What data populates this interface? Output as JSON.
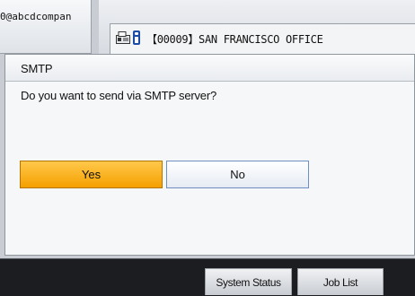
{
  "background": {
    "address_text": "0@abcdcompan",
    "destination_text": "【00009】SAN FRANCISCO OFFICE"
  },
  "dialog": {
    "title": "SMTP",
    "message": "Do you want to send via SMTP server?",
    "yes_label": "Yes",
    "no_label": "No"
  },
  "bottom_bar": {
    "system_status_label": "System Status",
    "job_list_label": "Job List"
  },
  "colors": {
    "accent_yes": "#f7a800",
    "no_border": "#6f8fc2",
    "bar_background": "#1b1d21"
  }
}
